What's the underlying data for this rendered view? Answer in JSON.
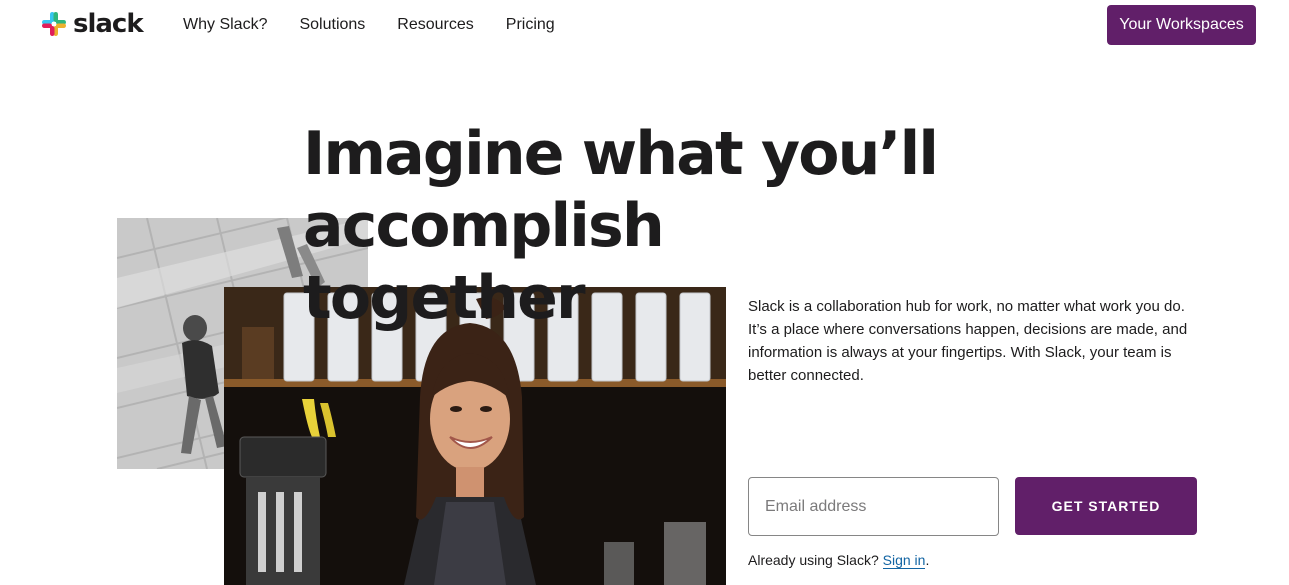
{
  "brand": {
    "name": "slack",
    "accent_color": "#611f69",
    "logo_colors": [
      "#36c5f0",
      "#2eb67d",
      "#ecb22e",
      "#e01e5a"
    ]
  },
  "nav": {
    "items": [
      {
        "label": "Why Slack?"
      },
      {
        "label": "Solutions"
      },
      {
        "label": "Resources"
      },
      {
        "label": "Pricing"
      }
    ],
    "workspaces_label": "Your Workspaces"
  },
  "hero": {
    "title_line1": "Imagine what you’ll",
    "title_line2": "accomplish together",
    "description": "Slack is a collaboration hub for work, no matter what work you do. It’s a place where conversations happen, decisions are made, and information is always at your fingertips. With Slack, your team is better connected.",
    "email_placeholder": "Email address",
    "cta_label": "GET STARTED",
    "signin_prefix": "Already using Slack?",
    "signin_link": "Sign in",
    "signin_suffix": "."
  }
}
